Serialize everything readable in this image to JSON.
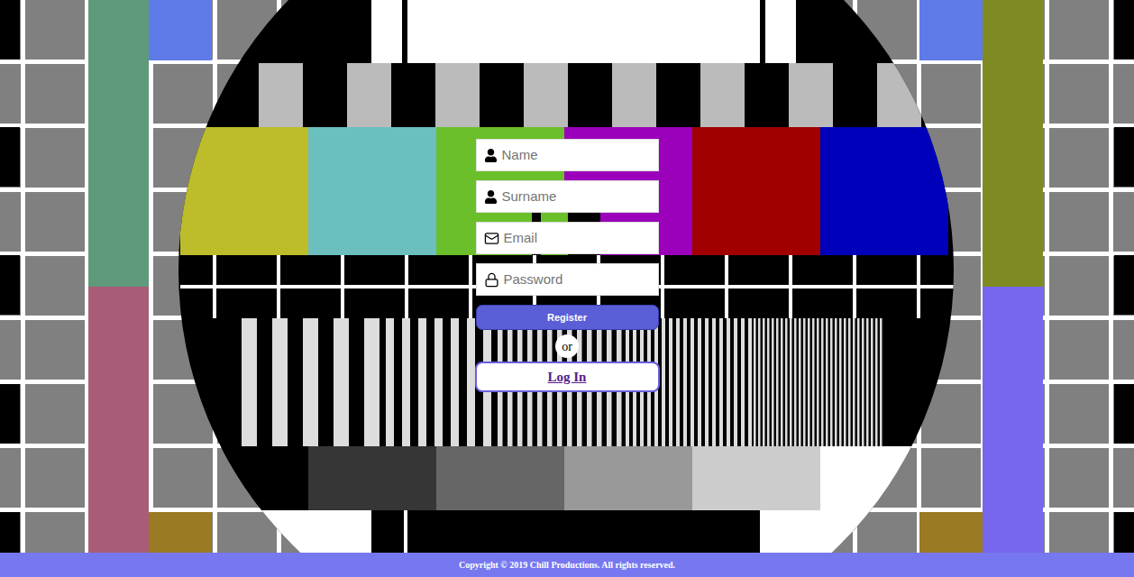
{
  "form": {
    "fields": [
      {
        "placeholder": "Name",
        "kind": "text"
      },
      {
        "placeholder": "Surname",
        "kind": "text"
      },
      {
        "placeholder": "Email",
        "kind": "email"
      },
      {
        "placeholder": "Password",
        "kind": "password"
      }
    ],
    "register_button": "Register",
    "separator": "or",
    "login_link": "Log In"
  },
  "footer": {
    "text": "Copyright © 2019 Chill Productions. All rights reserved."
  }
}
